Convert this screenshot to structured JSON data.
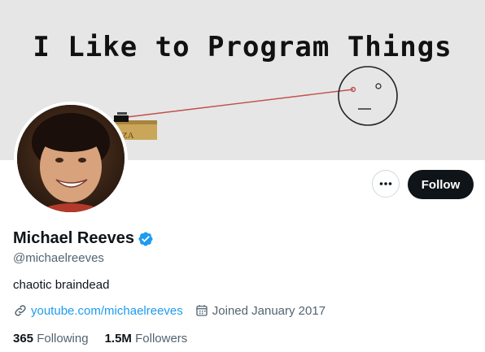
{
  "banner": {
    "title": "I Like to Program Things",
    "box_label": "ZA"
  },
  "actions": {
    "more_label": "More",
    "follow_label": "Follow"
  },
  "profile": {
    "display_name": "Michael Reeves",
    "handle": "@michaelreeves",
    "bio": "chaotic braindead",
    "link": "youtube.com/michaelreeves",
    "joined": "Joined January 2017"
  },
  "stats": {
    "following_count": "365",
    "following_label": "Following",
    "followers_count": "1.5M",
    "followers_label": "Followers"
  },
  "colors": {
    "accent": "#1d9bf0",
    "text": "#0f1419",
    "muted": "#536471",
    "banner_bg": "#e6e6e6"
  },
  "icons": [
    "more-icon",
    "verified-badge-icon",
    "link-icon",
    "calendar-icon"
  ]
}
